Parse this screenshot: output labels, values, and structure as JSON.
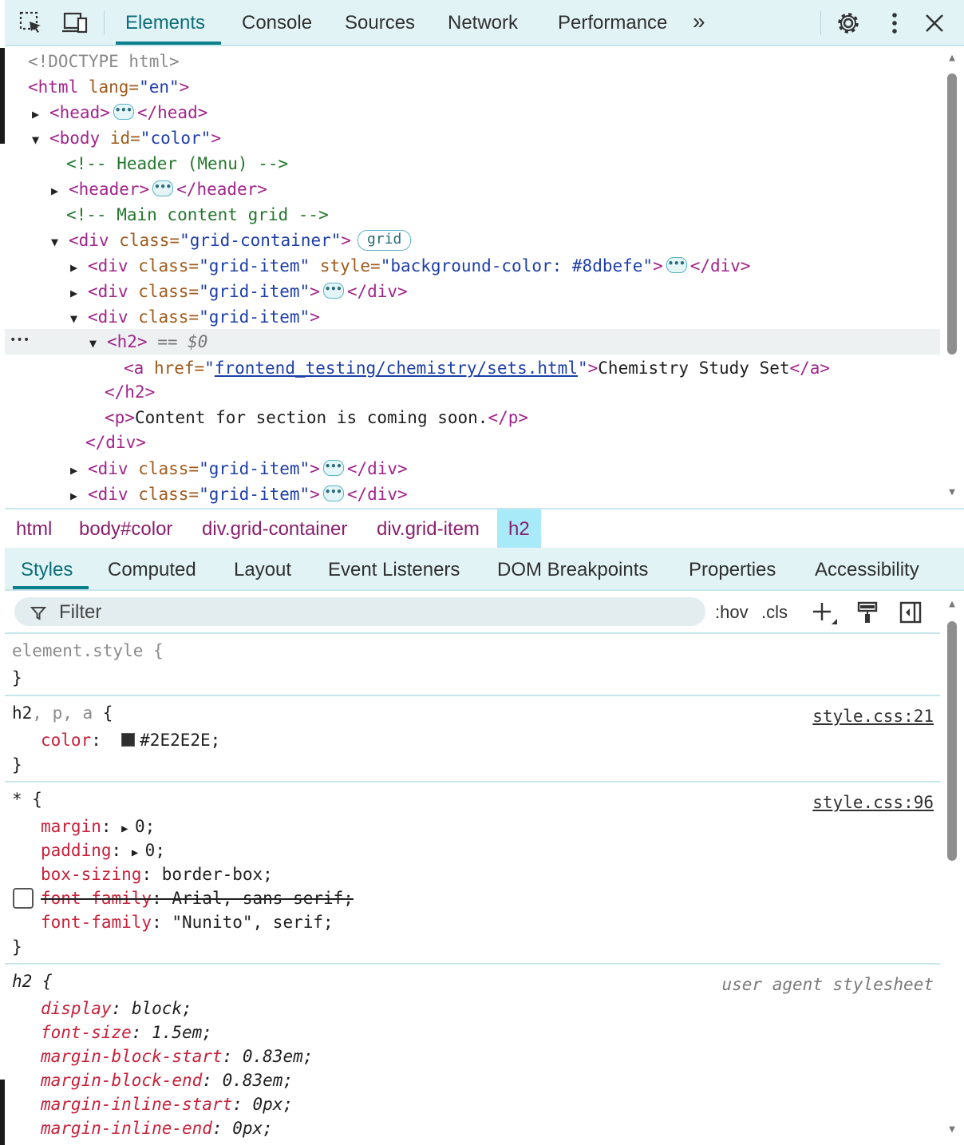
{
  "toolbar": {
    "tabs": [
      "Elements",
      "Console",
      "Sources",
      "Network",
      "Performance"
    ],
    "more_label": "»"
  },
  "tree": {
    "doctype": "<!DOCTYPE html>",
    "html_open": "<html",
    "html_lang_attr": " lang=",
    "html_lang_val": "\"en\"",
    "head_open": "<head>",
    "head_close": "</head>",
    "body_open": "<body",
    "body_id_attr": " id=",
    "body_id_val": "\"color\"",
    "comment_header": "<!-- Header (Menu) -->",
    "header_open": "<header>",
    "header_close": "</header>",
    "comment_main": "<!-- Main content grid -->",
    "div_open": "<div",
    "class_attr": " class=",
    "grid_container_val": "\"grid-container\"",
    "grid_badge": "grid",
    "grid_item_val": "\"grid-item\"",
    "style_attr": " style=",
    "style_val": "\"background-color: #8dbefe\"",
    "div_close": "</div>",
    "gt": ">",
    "h2_open": "<h2>",
    "selected_marker": " == $0",
    "a_open": "<a",
    "href_attr": " href=",
    "href_val": "frontend_testing/chemistry/sets.html",
    "a_text": "Chemistry Study Set",
    "a_close": "</a>",
    "h2_close": "</h2>",
    "p_open": "<p>",
    "p_text": "Content for section is coming soon.",
    "p_close": "</p>",
    "quote": "\""
  },
  "breadcrumbs": [
    "html",
    "body#color",
    "div.grid-container",
    "div.grid-item",
    "h2"
  ],
  "subtabs": [
    "Styles",
    "Computed",
    "Layout",
    "Event Listeners",
    "DOM Breakpoints",
    "Properties",
    "Accessibility"
  ],
  "filter": {
    "placeholder": "Filter",
    "hov": ":hov",
    "cls": ".cls"
  },
  "styles": {
    "element_style": "element.style {",
    "close_brace": "}",
    "rule1": {
      "selector_main": "h2",
      "selector_rest": ", p, a",
      "open": " {",
      "source": "style.css:21",
      "prop": "color",
      "value": "#2E2E2E;"
    },
    "rule2": {
      "selector": "* {",
      "source": "style.css:96",
      "decls": [
        {
          "prop": "margin",
          "value": "0;"
        },
        {
          "prop": "padding",
          "value": "0;"
        },
        {
          "prop": "box-sizing",
          "value": "border-box;"
        },
        {
          "prop": "font-family",
          "value": "Arial, sans-serif;"
        },
        {
          "prop": "font-family",
          "value": "\"Nunito\", serif;"
        }
      ]
    },
    "rule3": {
      "selector": "h2 {",
      "source": "user agent stylesheet",
      "decls": [
        {
          "prop": "display",
          "value": "block;"
        },
        {
          "prop": "font-size",
          "value": "1.5em;"
        },
        {
          "prop": "margin-block-start",
          "value": "0.83em;"
        },
        {
          "prop": "margin-block-end",
          "value": "0.83em;"
        },
        {
          "prop": "margin-inline-start",
          "value": "0px;"
        },
        {
          "prop": "margin-inline-end",
          "value": "0px;"
        }
      ]
    }
  },
  "colors": {
    "accent": "#0b7f8a",
    "toolbar_bg": "#e2f3f6",
    "selected_crumb_bg": "#a8eaf7",
    "color_swatch": "#2E2E2E"
  }
}
